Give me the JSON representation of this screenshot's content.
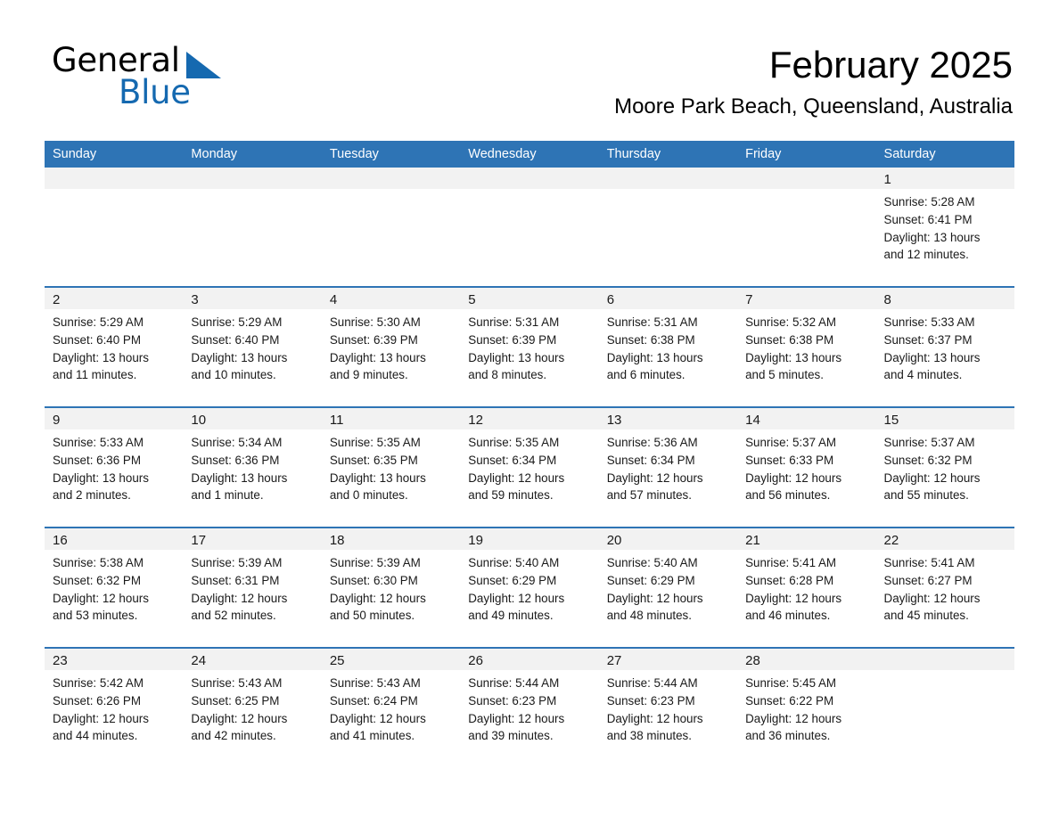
{
  "brand": {
    "line1": "General",
    "line2": "Blue",
    "triangle_color": "#1569b0"
  },
  "header": {
    "title": "February 2025",
    "subtitle": "Moore Park Beach, Queensland, Australia",
    "accent_color": "#2e74b5",
    "daynum_bg": "#f2f2f2"
  },
  "weekdays": [
    "Sunday",
    "Monday",
    "Tuesday",
    "Wednesday",
    "Thursday",
    "Friday",
    "Saturday"
  ],
  "labels": {
    "sunrise": "Sunrise:",
    "sunset": "Sunset:",
    "daylight": "Daylight:"
  },
  "weeks": [
    [
      {
        "day": "",
        "empty": true
      },
      {
        "day": "",
        "empty": true
      },
      {
        "day": "",
        "empty": true
      },
      {
        "day": "",
        "empty": true
      },
      {
        "day": "",
        "empty": true
      },
      {
        "day": "",
        "empty": true
      },
      {
        "day": "1",
        "sunrise": "Sunrise: 5:28 AM",
        "sunset": "Sunset: 6:41 PM",
        "daylight_1": "Daylight: 13 hours",
        "daylight_2": "and 12 minutes."
      }
    ],
    [
      {
        "day": "2",
        "sunrise": "Sunrise: 5:29 AM",
        "sunset": "Sunset: 6:40 PM",
        "daylight_1": "Daylight: 13 hours",
        "daylight_2": "and 11 minutes."
      },
      {
        "day": "3",
        "sunrise": "Sunrise: 5:29 AM",
        "sunset": "Sunset: 6:40 PM",
        "daylight_1": "Daylight: 13 hours",
        "daylight_2": "and 10 minutes."
      },
      {
        "day": "4",
        "sunrise": "Sunrise: 5:30 AM",
        "sunset": "Sunset: 6:39 PM",
        "daylight_1": "Daylight: 13 hours",
        "daylight_2": "and 9 minutes."
      },
      {
        "day": "5",
        "sunrise": "Sunrise: 5:31 AM",
        "sunset": "Sunset: 6:39 PM",
        "daylight_1": "Daylight: 13 hours",
        "daylight_2": "and 8 minutes."
      },
      {
        "day": "6",
        "sunrise": "Sunrise: 5:31 AM",
        "sunset": "Sunset: 6:38 PM",
        "daylight_1": "Daylight: 13 hours",
        "daylight_2": "and 6 minutes."
      },
      {
        "day": "7",
        "sunrise": "Sunrise: 5:32 AM",
        "sunset": "Sunset: 6:38 PM",
        "daylight_1": "Daylight: 13 hours",
        "daylight_2": "and 5 minutes."
      },
      {
        "day": "8",
        "sunrise": "Sunrise: 5:33 AM",
        "sunset": "Sunset: 6:37 PM",
        "daylight_1": "Daylight: 13 hours",
        "daylight_2": "and 4 minutes."
      }
    ],
    [
      {
        "day": "9",
        "sunrise": "Sunrise: 5:33 AM",
        "sunset": "Sunset: 6:36 PM",
        "daylight_1": "Daylight: 13 hours",
        "daylight_2": "and 2 minutes."
      },
      {
        "day": "10",
        "sunrise": "Sunrise: 5:34 AM",
        "sunset": "Sunset: 6:36 PM",
        "daylight_1": "Daylight: 13 hours",
        "daylight_2": "and 1 minute."
      },
      {
        "day": "11",
        "sunrise": "Sunrise: 5:35 AM",
        "sunset": "Sunset: 6:35 PM",
        "daylight_1": "Daylight: 13 hours",
        "daylight_2": "and 0 minutes."
      },
      {
        "day": "12",
        "sunrise": "Sunrise: 5:35 AM",
        "sunset": "Sunset: 6:34 PM",
        "daylight_1": "Daylight: 12 hours",
        "daylight_2": "and 59 minutes."
      },
      {
        "day": "13",
        "sunrise": "Sunrise: 5:36 AM",
        "sunset": "Sunset: 6:34 PM",
        "daylight_1": "Daylight: 12 hours",
        "daylight_2": "and 57 minutes."
      },
      {
        "day": "14",
        "sunrise": "Sunrise: 5:37 AM",
        "sunset": "Sunset: 6:33 PM",
        "daylight_1": "Daylight: 12 hours",
        "daylight_2": "and 56 minutes."
      },
      {
        "day": "15",
        "sunrise": "Sunrise: 5:37 AM",
        "sunset": "Sunset: 6:32 PM",
        "daylight_1": "Daylight: 12 hours",
        "daylight_2": "and 55 minutes."
      }
    ],
    [
      {
        "day": "16",
        "sunrise": "Sunrise: 5:38 AM",
        "sunset": "Sunset: 6:32 PM",
        "daylight_1": "Daylight: 12 hours",
        "daylight_2": "and 53 minutes."
      },
      {
        "day": "17",
        "sunrise": "Sunrise: 5:39 AM",
        "sunset": "Sunset: 6:31 PM",
        "daylight_1": "Daylight: 12 hours",
        "daylight_2": "and 52 minutes."
      },
      {
        "day": "18",
        "sunrise": "Sunrise: 5:39 AM",
        "sunset": "Sunset: 6:30 PM",
        "daylight_1": "Daylight: 12 hours",
        "daylight_2": "and 50 minutes."
      },
      {
        "day": "19",
        "sunrise": "Sunrise: 5:40 AM",
        "sunset": "Sunset: 6:29 PM",
        "daylight_1": "Daylight: 12 hours",
        "daylight_2": "and 49 minutes."
      },
      {
        "day": "20",
        "sunrise": "Sunrise: 5:40 AM",
        "sunset": "Sunset: 6:29 PM",
        "daylight_1": "Daylight: 12 hours",
        "daylight_2": "and 48 minutes."
      },
      {
        "day": "21",
        "sunrise": "Sunrise: 5:41 AM",
        "sunset": "Sunset: 6:28 PM",
        "daylight_1": "Daylight: 12 hours",
        "daylight_2": "and 46 minutes."
      },
      {
        "day": "22",
        "sunrise": "Sunrise: 5:41 AM",
        "sunset": "Sunset: 6:27 PM",
        "daylight_1": "Daylight: 12 hours",
        "daylight_2": "and 45 minutes."
      }
    ],
    [
      {
        "day": "23",
        "sunrise": "Sunrise: 5:42 AM",
        "sunset": "Sunset: 6:26 PM",
        "daylight_1": "Daylight: 12 hours",
        "daylight_2": "and 44 minutes."
      },
      {
        "day": "24",
        "sunrise": "Sunrise: 5:43 AM",
        "sunset": "Sunset: 6:25 PM",
        "daylight_1": "Daylight: 12 hours",
        "daylight_2": "and 42 minutes."
      },
      {
        "day": "25",
        "sunrise": "Sunrise: 5:43 AM",
        "sunset": "Sunset: 6:24 PM",
        "daylight_1": "Daylight: 12 hours",
        "daylight_2": "and 41 minutes."
      },
      {
        "day": "26",
        "sunrise": "Sunrise: 5:44 AM",
        "sunset": "Sunset: 6:23 PM",
        "daylight_1": "Daylight: 12 hours",
        "daylight_2": "and 39 minutes."
      },
      {
        "day": "27",
        "sunrise": "Sunrise: 5:44 AM",
        "sunset": "Sunset: 6:23 PM",
        "daylight_1": "Daylight: 12 hours",
        "daylight_2": "and 38 minutes."
      },
      {
        "day": "28",
        "sunrise": "Sunrise: 5:45 AM",
        "sunset": "Sunset: 6:22 PM",
        "daylight_1": "Daylight: 12 hours",
        "daylight_2": "and 36 minutes."
      },
      {
        "day": "",
        "empty": true
      }
    ]
  ]
}
